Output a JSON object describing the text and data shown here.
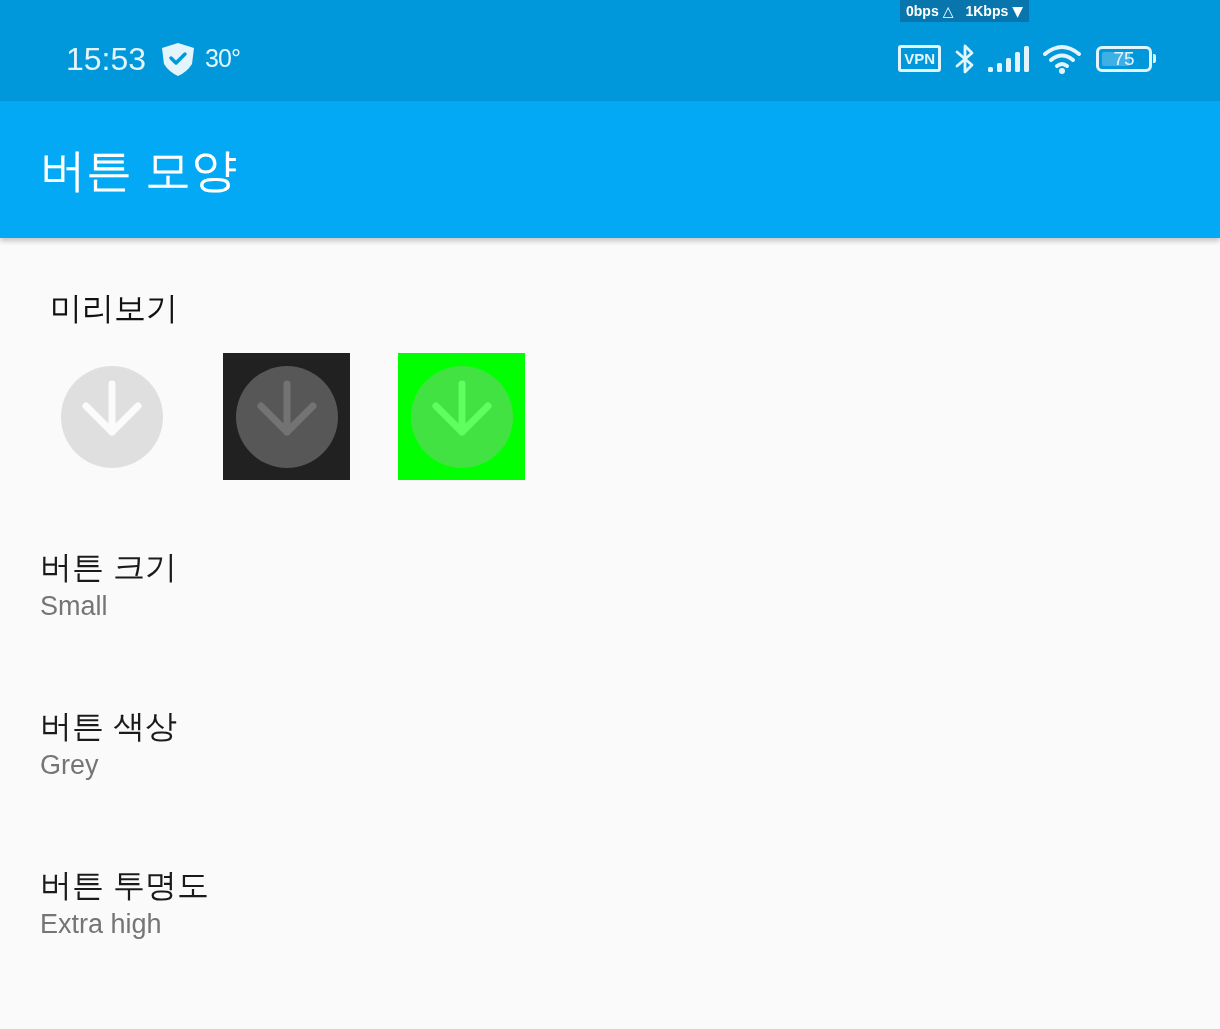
{
  "status_bar": {
    "time": "15:53",
    "temperature": "30°",
    "network_speed": {
      "upload": "0bps",
      "upload_glyph": "△",
      "download": "1Kbps",
      "download_glyph": "▼"
    },
    "vpn": "VPN",
    "battery": "75"
  },
  "app_bar": {
    "title": "버튼 모양"
  },
  "preview": {
    "heading": "미리보기",
    "items": [
      {
        "kind": "plain"
      },
      {
        "kind": "backdrop",
        "color": "#212121"
      },
      {
        "kind": "backdrop",
        "color": "#00ff00"
      }
    ]
  },
  "settings": [
    {
      "title": "버튼 크기",
      "value": "Small"
    },
    {
      "title": "버튼 색상",
      "value": "Grey"
    },
    {
      "title": "버튼 투명도",
      "value": "Extra high"
    }
  ]
}
